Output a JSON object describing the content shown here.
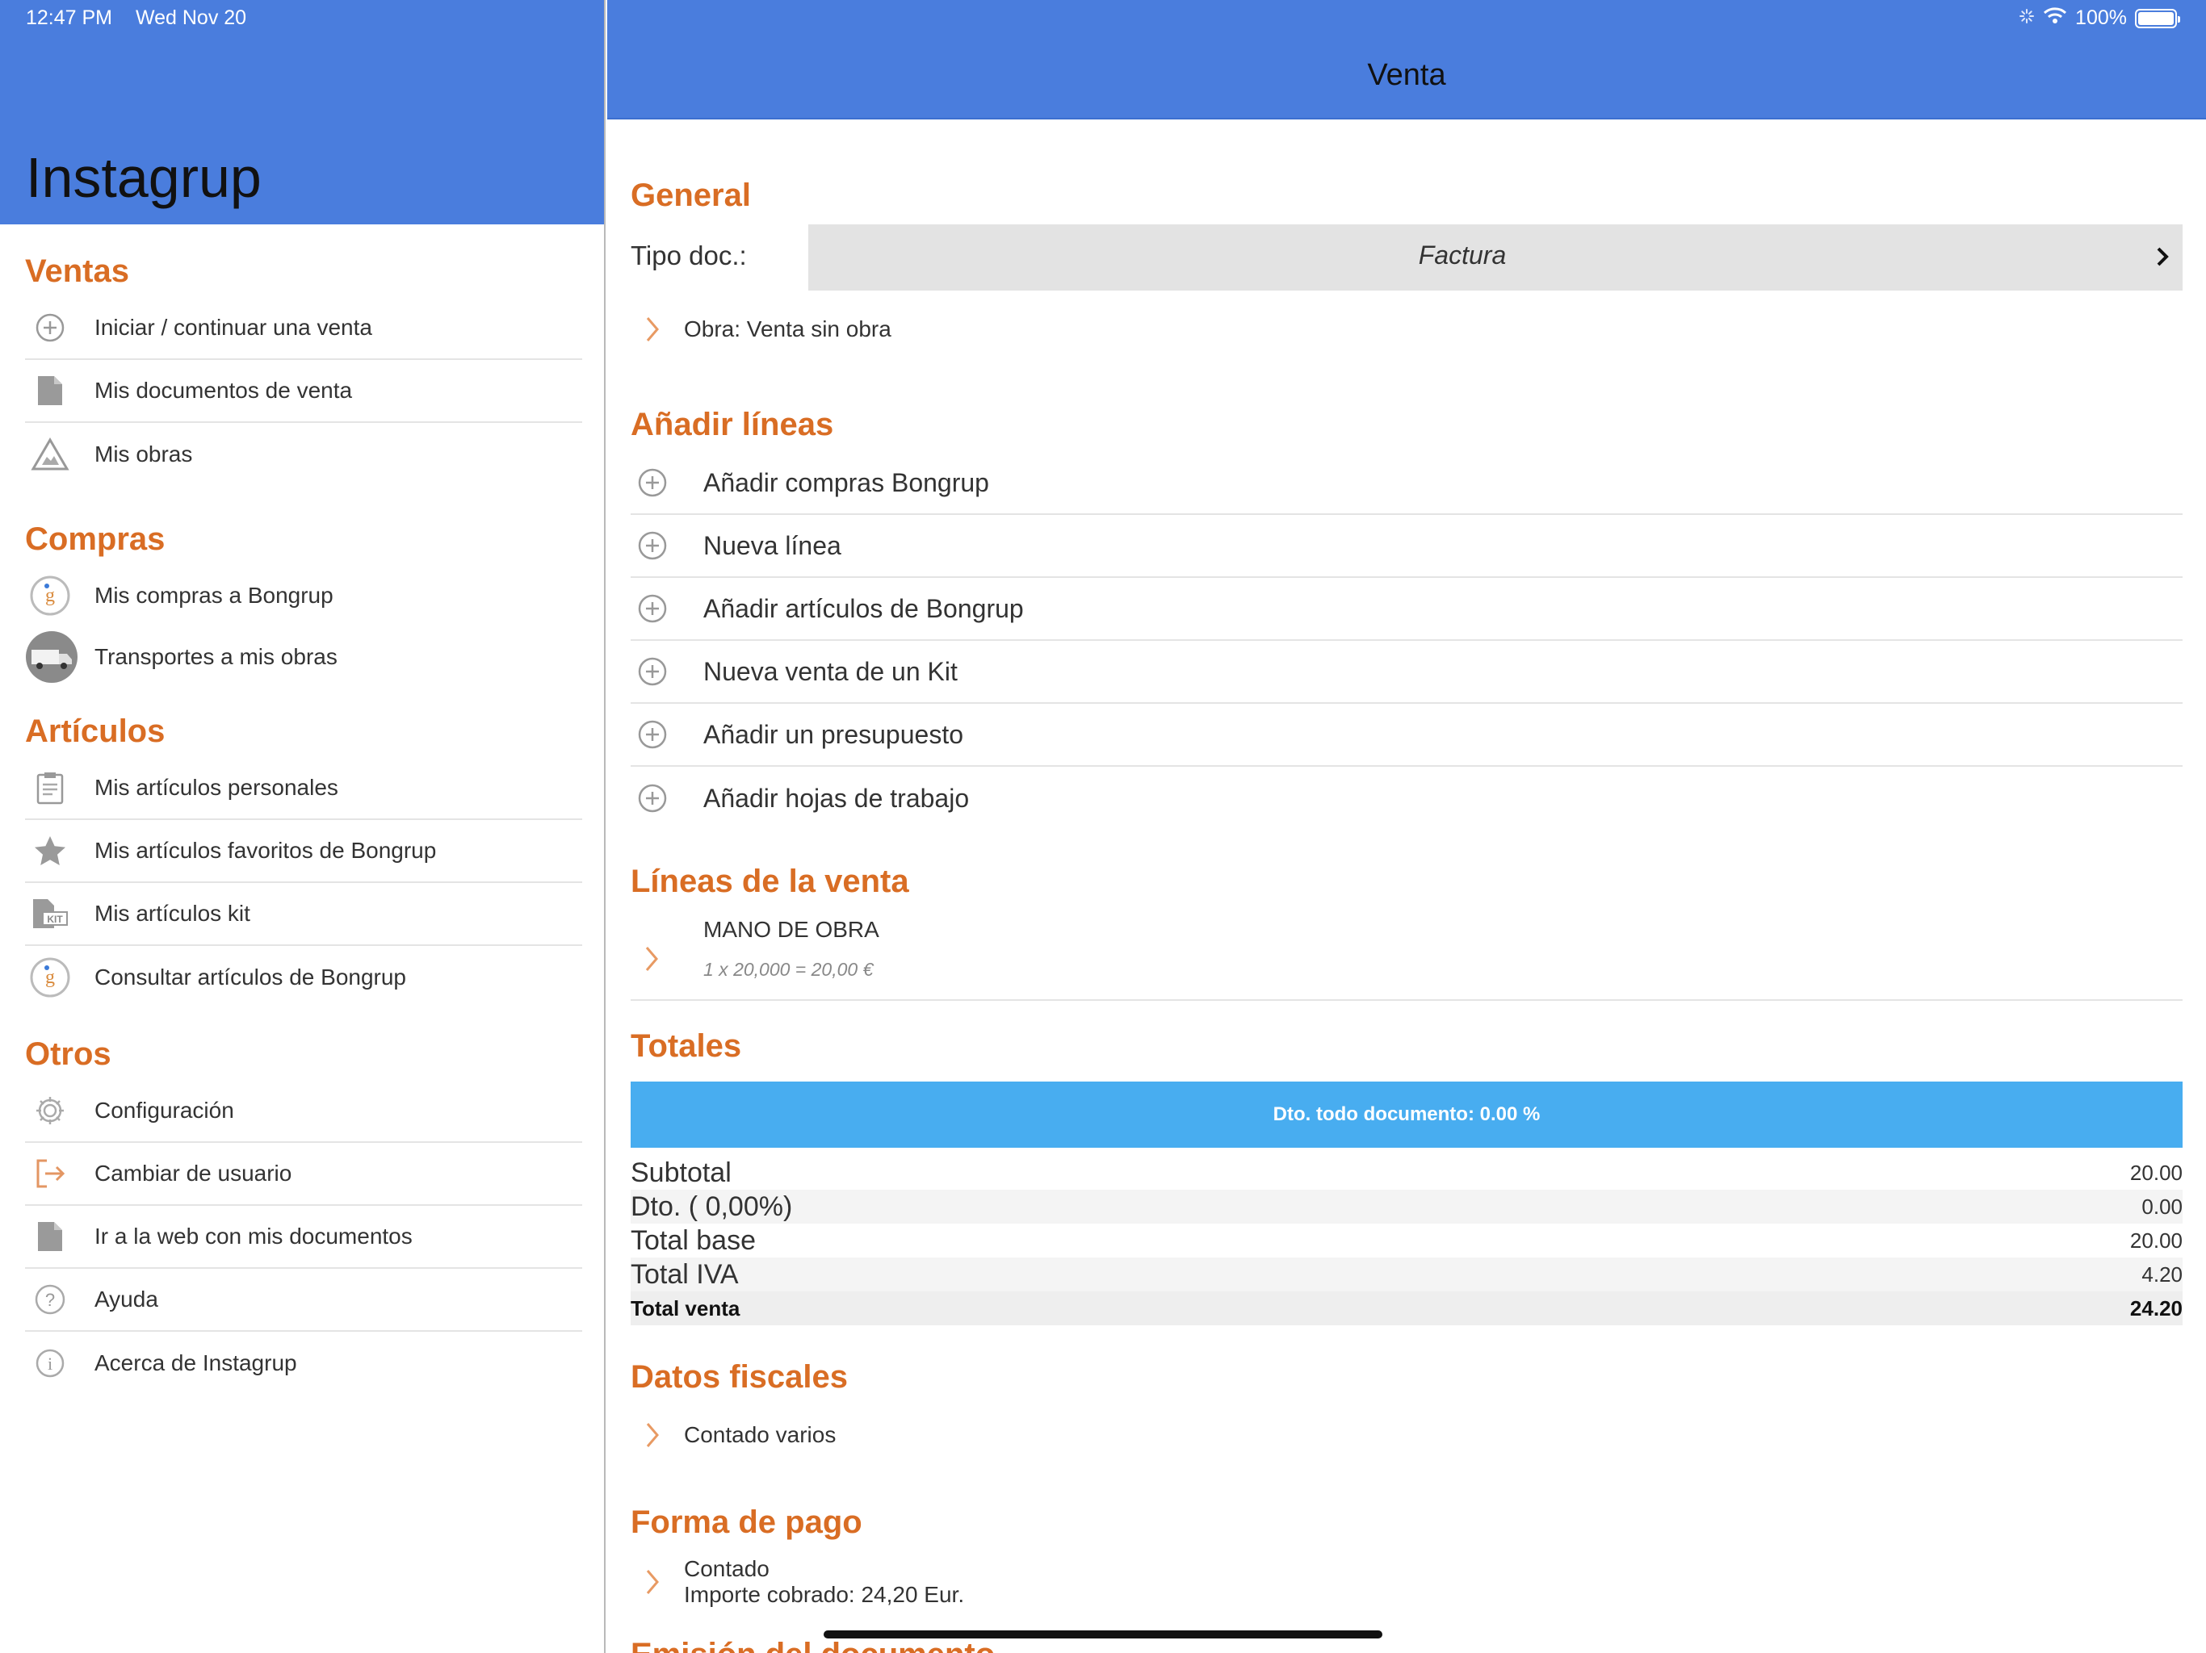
{
  "status_bar": {
    "time": "12:47 PM",
    "date": "Wed Nov 20",
    "battery": "100%"
  },
  "sidebar": {
    "title": "Instagrup",
    "sections": [
      {
        "title": "Ventas",
        "items": [
          {
            "label": "Iniciar / continuar una venta",
            "icon": "plus-circle-icon"
          },
          {
            "label": "Mis documentos de venta",
            "icon": "document-icon"
          },
          {
            "label": "Mis obras",
            "icon": "construction-sign-icon"
          }
        ]
      },
      {
        "title": "Compras",
        "items": [
          {
            "label": "Mis compras a Bongrup",
            "icon": "bongrup-logo-icon"
          },
          {
            "label": "Transportes a mis obras",
            "icon": "truck-icon"
          }
        ]
      },
      {
        "title": "Artículos",
        "items": [
          {
            "label": "Mis artículos personales",
            "icon": "clipboard-icon"
          },
          {
            "label": "Mis artículos favoritos de Bongrup",
            "icon": "star-icon"
          },
          {
            "label": "Mis artículos kit",
            "icon": "kit-document-icon"
          },
          {
            "label": "Consultar artículos de Bongrup",
            "icon": "bongrup-logo-icon"
          }
        ]
      },
      {
        "title": "Otros",
        "items": [
          {
            "label": "Configuración",
            "icon": "gear-icon"
          },
          {
            "label": "Cambiar de usuario",
            "icon": "logout-icon"
          },
          {
            "label": "Ir a la web con mis documentos",
            "icon": "document-icon"
          },
          {
            "label": "Ayuda",
            "icon": "help-icon"
          },
          {
            "label": "Acerca de Instagrup",
            "icon": "info-icon"
          }
        ]
      }
    ]
  },
  "main": {
    "title": "Venta",
    "general": {
      "title": "General",
      "tipo_label": "Tipo doc.:",
      "tipo_value": "Factura",
      "obra": "Obra: Venta sin obra"
    },
    "anadir": {
      "title": "Añadir líneas",
      "items": [
        "Añadir compras Bongrup",
        "Nueva línea",
        "Añadir artículos de Bongrup",
        "Nueva venta de un Kit",
        "Añadir un presupuesto",
        "Añadir hojas de trabajo"
      ]
    },
    "lineas": {
      "title": "Líneas de la venta",
      "items": [
        {
          "name": "MANO DE OBRA",
          "detail": "1 x 20,000 = 20,00 €"
        }
      ]
    },
    "totales": {
      "title": "Totales",
      "dto_button": "Dto. todo documento: 0.00 %",
      "rows": [
        {
          "label": "Subtotal",
          "value": "20.00"
        },
        {
          "label": "Dto. ( 0,00%)",
          "value": "0.00"
        },
        {
          "label": "Total base",
          "value": "20.00"
        },
        {
          "label": "Total IVA",
          "value": "4.20"
        },
        {
          "label": "Total venta",
          "value": "24.20"
        }
      ]
    },
    "fiscales": {
      "title": "Datos fiscales",
      "value": "Contado varios"
    },
    "pago": {
      "title": "Forma de pago",
      "line1": "Contado",
      "line2": "Importe cobrado: 24,20 Eur."
    },
    "cut_section_title": "Emisión del documento"
  },
  "colors": {
    "header_blue": "#4a7ddd",
    "section_orange": "#d96d24",
    "button_blue": "#48adf0",
    "chevron_orange": "#e89a63"
  }
}
